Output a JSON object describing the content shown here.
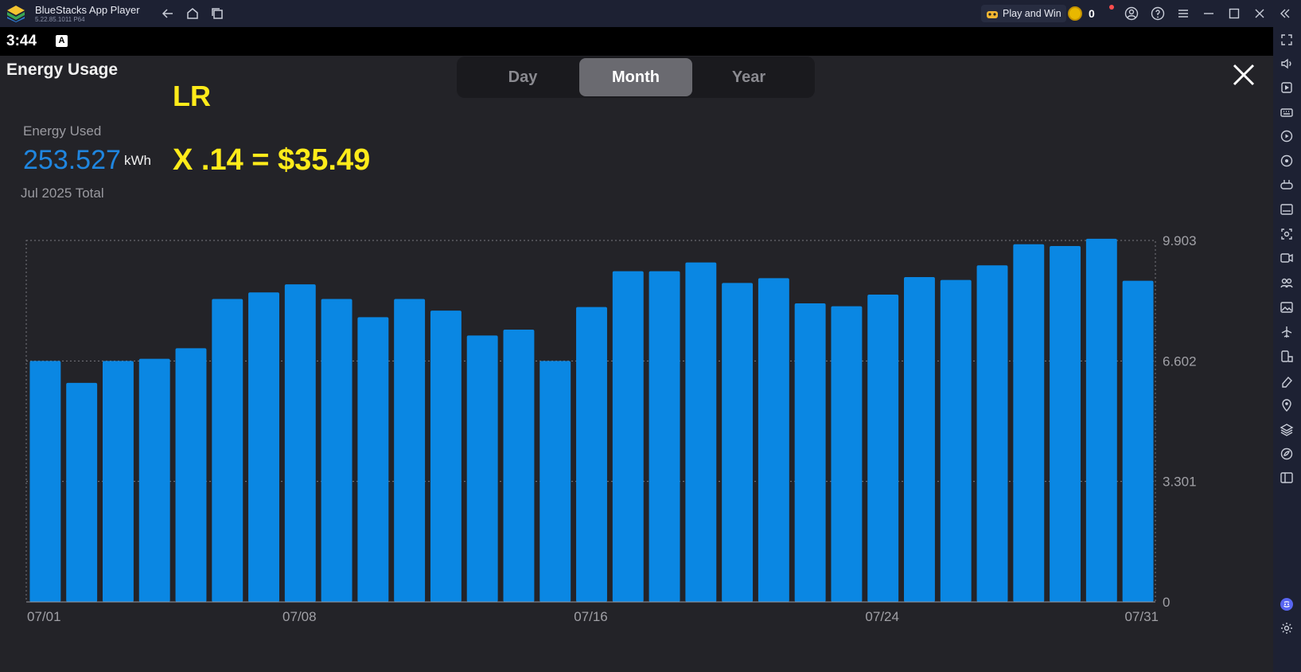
{
  "window": {
    "title": "BlueStacks App Player",
    "version": "5.22.85.1011 P64",
    "play_and_win": "Play and Win",
    "coin_count": "0"
  },
  "statusbar": {
    "time": "3:44",
    "indicator": "A"
  },
  "app": {
    "title": "Energy Usage",
    "tabs": [
      {
        "label": "Day",
        "active": false
      },
      {
        "label": "Month",
        "active": true
      },
      {
        "label": "Year",
        "active": false
      }
    ],
    "annotation_lr": "LR",
    "energy_used_label": "Energy Used",
    "energy_value": "253.527",
    "energy_unit": "kWh",
    "annotation_formula": "X .14 = $35.49",
    "period_label": "Jul 2025 Total"
  },
  "chart_data": {
    "type": "bar",
    "color": "#0a87e3",
    "categories": [
      "07/01",
      "07/02",
      "07/03",
      "07/04",
      "07/05",
      "07/06",
      "07/07",
      "07/08",
      "07/09",
      "07/10",
      "07/11",
      "07/12",
      "07/13",
      "07/14",
      "07/15",
      "07/16",
      "07/17",
      "07/18",
      "07/19",
      "07/20",
      "07/21",
      "07/22",
      "07/23",
      "07/24",
      "07/25",
      "07/26",
      "07/27",
      "07/28",
      "07/29",
      "07/30",
      "07/31"
    ],
    "values": [
      6.6,
      6.0,
      6.6,
      6.66,
      6.95,
      8.3,
      8.48,
      8.7,
      8.3,
      7.8,
      8.3,
      7.98,
      7.3,
      7.46,
      6.6,
      8.08,
      9.06,
      9.06,
      9.3,
      8.74,
      8.87,
      8.18,
      8.1,
      8.42,
      8.9,
      8.82,
      9.22,
      9.8,
      9.75,
      9.95,
      8.8
    ],
    "x_tick_labels": [
      "07/01",
      "07/08",
      "07/16",
      "07/24",
      "07/31"
    ],
    "y_tick_labels": [
      "9.903",
      "6.602",
      "3.301",
      "0"
    ],
    "ylim": [
      0,
      9.903
    ],
    "grid": true
  },
  "sidebar": {
    "icons": [
      "expand-icon",
      "volume-icon",
      "screen-record-icon",
      "keyboard-icon",
      "macro-icon",
      "location-icon",
      "gamepad-icon",
      "apk-icon",
      "screenshot-icon",
      "record-icon",
      "multi-instance-icon",
      "media-icon",
      "airplane-icon",
      "rotate-icon",
      "eraser-icon",
      "pin-icon",
      "layers-icon",
      "eco-icon",
      "sidebar-toggle-icon",
      "discord-icon",
      "settings-icon"
    ]
  }
}
